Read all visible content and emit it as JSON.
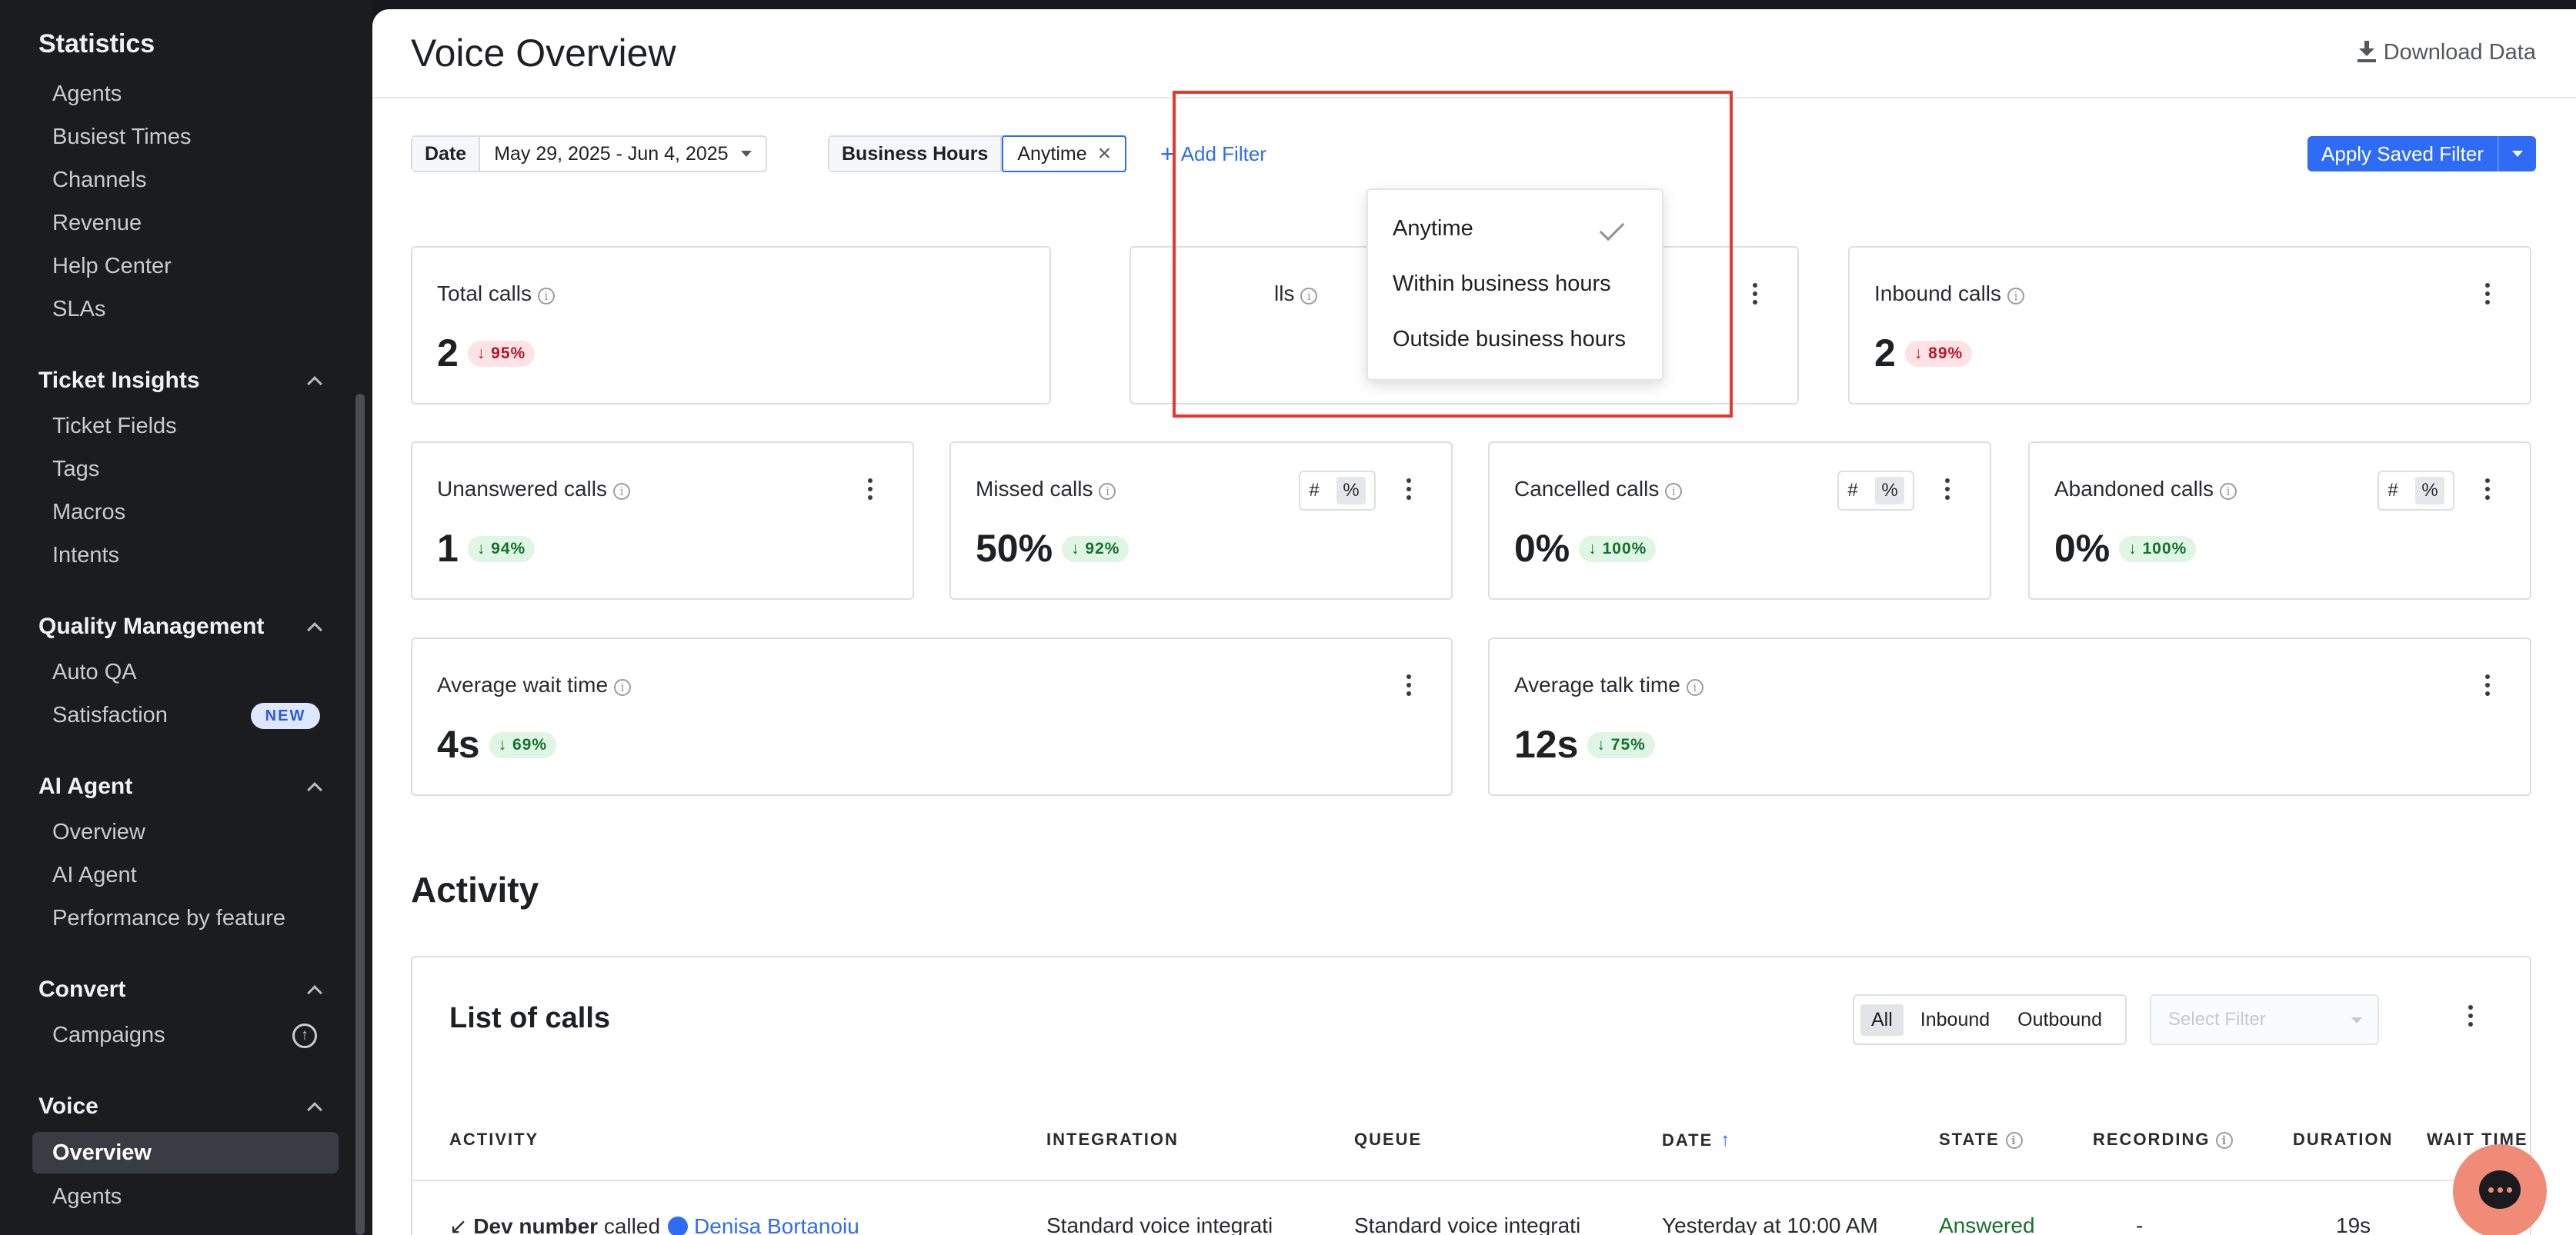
{
  "sidebar": {
    "statistics": {
      "title": "Statistics",
      "items": [
        "Agents",
        "Busiest Times",
        "Channels",
        "Revenue",
        "Help Center",
        "SLAs"
      ]
    },
    "ticket_insights": {
      "title": "Ticket Insights",
      "items": [
        "Ticket Fields",
        "Tags",
        "Macros",
        "Intents"
      ]
    },
    "quality": {
      "title": "Quality Management",
      "items": [
        "Auto QA",
        "Satisfaction"
      ],
      "badge": "NEW"
    },
    "ai_agent": {
      "title": "AI Agent",
      "items": [
        "Overview",
        "AI Agent",
        "Performance by feature"
      ]
    },
    "convert": {
      "title": "Convert",
      "items": [
        "Campaigns"
      ]
    },
    "voice": {
      "title": "Voice",
      "items": [
        "Overview",
        "Agents"
      ],
      "active": "Overview"
    }
  },
  "header": {
    "title": "Voice Overview",
    "download_label": "Download Data"
  },
  "filters": {
    "date_label": "Date",
    "date_value": "May 29, 2025 - Jun 4, 2025",
    "business_hours_label": "Business Hours",
    "business_hours_value": "Anytime",
    "add_filter_label": "Add Filter",
    "apply_saved_filter_label": "Apply Saved Filter"
  },
  "dropdown": {
    "options": [
      "Anytime",
      "Within business hours",
      "Outside business hours"
    ],
    "selected": "Anytime"
  },
  "metrics": {
    "total_calls": {
      "title": "Total calls",
      "value": "2",
      "delta": "95%",
      "trend": "down",
      "tone": "red"
    },
    "outbound_calls": {
      "title_visible": "lls",
      "value": ""
    },
    "inbound_calls": {
      "title": "Inbound calls",
      "value": "2",
      "delta": "89%",
      "trend": "down",
      "tone": "red"
    },
    "unanswered_calls": {
      "title": "Unanswered calls",
      "value": "1",
      "delta": "94%",
      "trend": "down",
      "tone": "green"
    },
    "missed_calls": {
      "title": "Missed calls",
      "value": "50%",
      "delta": "92%",
      "trend": "down",
      "tone": "green"
    },
    "cancelled_calls": {
      "title": "Cancelled calls",
      "value": "0%",
      "delta": "100%",
      "trend": "down",
      "tone": "green"
    },
    "abandoned_calls": {
      "title": "Abandoned calls",
      "value": "0%",
      "delta": "100%",
      "trend": "down",
      "tone": "green"
    },
    "avg_wait": {
      "title": "Average wait time",
      "value": "4s",
      "delta": "69%",
      "trend": "down",
      "tone": "green"
    },
    "avg_talk": {
      "title": "Average talk time",
      "value": "12s",
      "delta": "75%",
      "trend": "down",
      "tone": "green"
    }
  },
  "toggle": {
    "hash": "#",
    "percent": "%"
  },
  "activity": {
    "title": "Activity",
    "list_title": "List of calls",
    "segments": [
      "All",
      "Inbound",
      "Outbound"
    ],
    "active_segment": "All",
    "select_filter_placeholder": "Select Filter",
    "columns": [
      "ACTIVITY",
      "INTEGRATION",
      "QUEUE",
      "DATE",
      "STATE",
      "RECORDING",
      "DURATION",
      "WAIT TIME"
    ],
    "rows": [
      {
        "from": "Dev number",
        "verb": "called",
        "user": "Denisa Bortanoiu",
        "integration": "Standard voice integrati",
        "queue": "Standard voice integrati",
        "date": "Yesterday at 10:00 AM",
        "state": "Answered",
        "recording": "-",
        "duration": "19s"
      }
    ]
  },
  "colors": {
    "accent": "#2f6cf5",
    "highlight_box": "#e8382d",
    "sidebar_bg": "#1b1c20",
    "chat_bubble": "#ef8b76"
  }
}
